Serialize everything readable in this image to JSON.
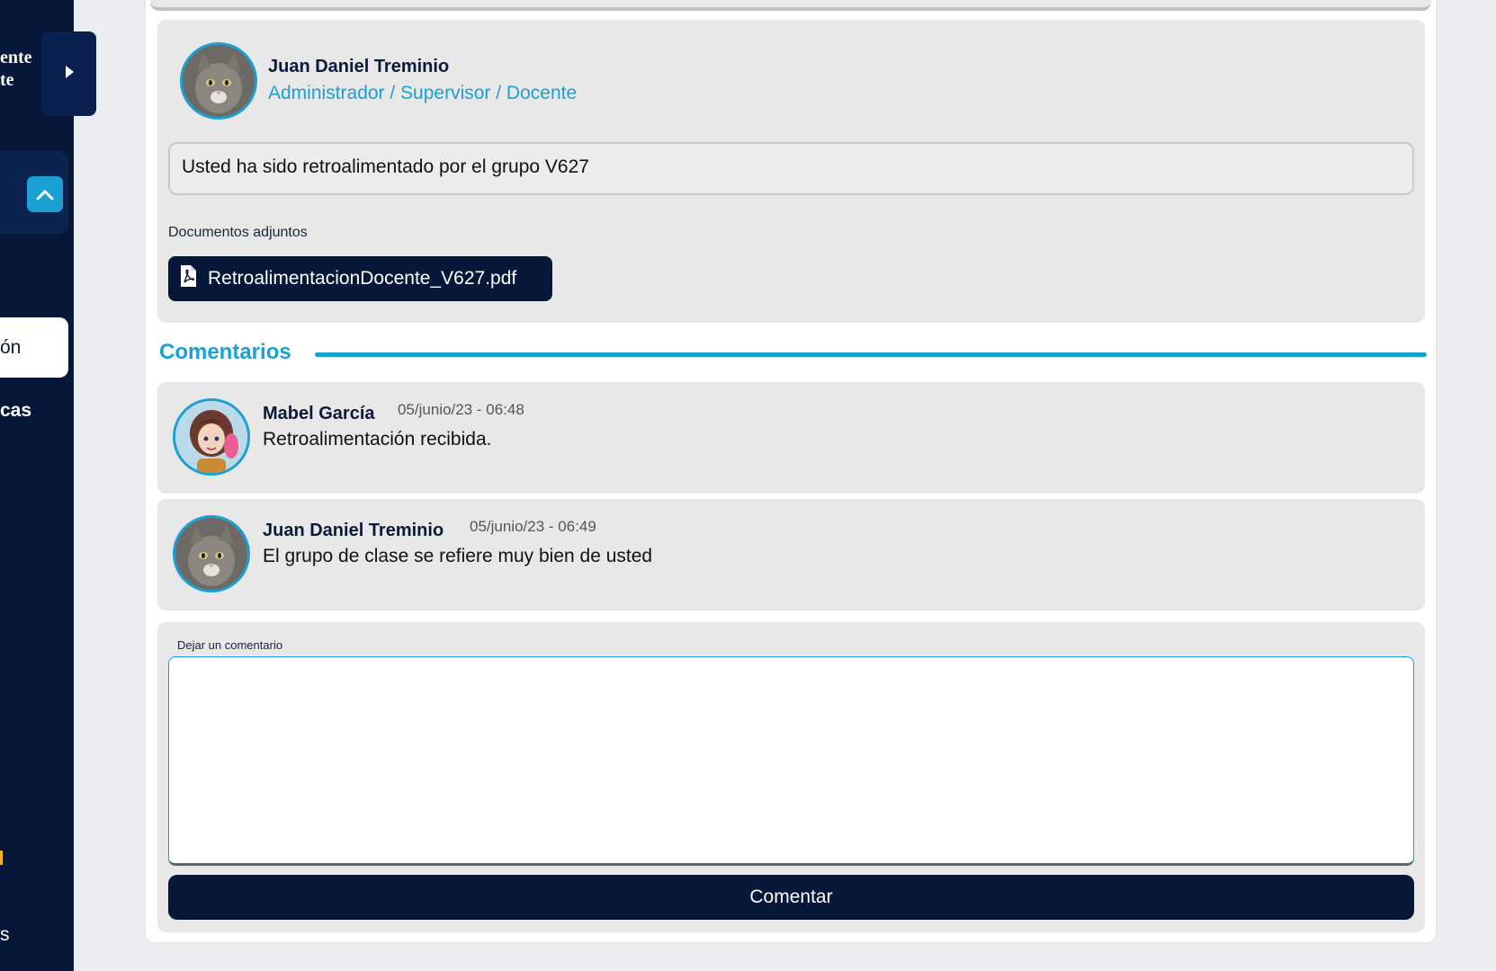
{
  "sidebar": {
    "header_line1": "ente",
    "header_line2": "te",
    "active_item": "ón",
    "item_below": "cas",
    "bottom_item": "s"
  },
  "post": {
    "author_name": "Juan Daniel Treminio",
    "author_role": "Administrador / Supervisor / Docente",
    "message": "Usted ha sido retroalimentado por el grupo V627",
    "attachments_label": "Documentos adjuntos",
    "attachment_file": "RetroalimentacionDocente_V627.pdf"
  },
  "comments_section": {
    "title": "Comentarios",
    "comments": [
      {
        "name": "Mabel García",
        "date": "05/junio/23 - 06:48",
        "text": "Retroalimentación recibida."
      },
      {
        "name": "Juan Daniel Treminio",
        "date": "05/junio/23 - 06:49",
        "text": "El grupo de clase se refiere muy bien de usted"
      }
    ]
  },
  "comment_form": {
    "label": "Dejar un comentario",
    "value": "",
    "submit_label": "Comentar"
  },
  "colors": {
    "navy": "#06173a",
    "accent": "#1aa0d4",
    "card": "#e8e8e8"
  }
}
